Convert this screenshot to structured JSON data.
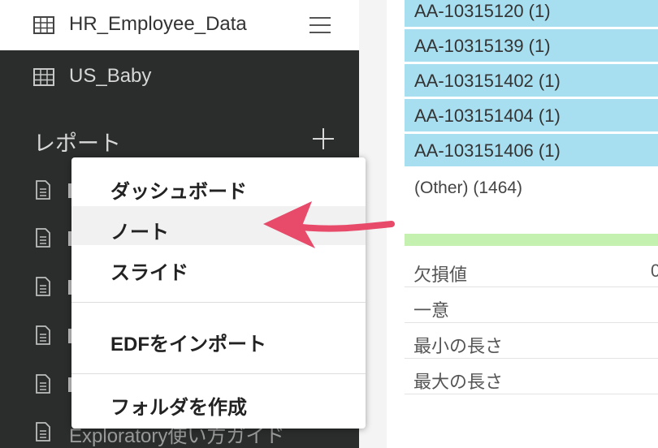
{
  "sidebar": {
    "top_item": {
      "label": "HR_Employee_Data",
      "icon": "table-icon"
    },
    "menu_icon": "hamburger-menu-icon",
    "items": [
      {
        "label": "US_Baby",
        "icon": "table-icon"
      }
    ],
    "report_section": {
      "label": "レポート",
      "add_icon": "plus-icon",
      "items": [
        {
          "label": "Exploratory使い方ガイド",
          "icon": "document-icon"
        }
      ]
    }
  },
  "dropdown": {
    "items": [
      {
        "label": "ダッシュボード"
      },
      {
        "label": "ノート",
        "highlighted": true
      },
      {
        "label": "スライド"
      },
      {
        "label": "EDFをインポート"
      },
      {
        "label": "フォルダを作成"
      }
    ]
  },
  "annotation": {
    "arrow_color": "#e84a6a",
    "icon": "pointer-arrow-icon"
  },
  "right_panel": {
    "values": [
      "AA-10315120 (1)",
      "AA-10315139 (1)",
      "AA-103151402 (1)",
      "AA-103151404 (1)",
      "AA-103151406 (1)"
    ],
    "other_label": "(Other) (1464)",
    "bar_color": "#a8dff0",
    "stats": [
      {
        "label": "欠損値",
        "value": "0"
      },
      {
        "label": "一意",
        "value": ""
      },
      {
        "label": "最小の長さ",
        "value": ""
      },
      {
        "label": "最大の長さ",
        "value": ""
      }
    ]
  }
}
